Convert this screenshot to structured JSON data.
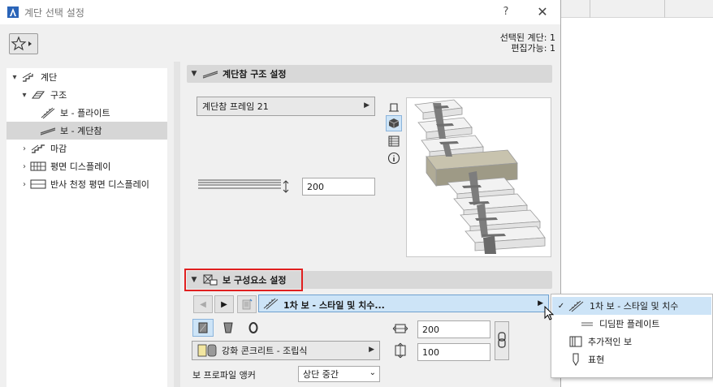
{
  "window": {
    "title": "계단 선택 설정",
    "help": "?",
    "close": "✕"
  },
  "selection_info": {
    "selected": "선택된 계단: 1",
    "editable": "편집가능: 1"
  },
  "tree": [
    {
      "label": "계단",
      "icon": "stair-icon",
      "expanded": true
    },
    {
      "label": "구조",
      "icon": "structure-icon",
      "expanded": true
    },
    {
      "label": "보 - 플라이트",
      "icon": "flight-beam-icon"
    },
    {
      "label": "보 - 계단참",
      "icon": "landing-beam-icon",
      "selected": true
    },
    {
      "label": "마감",
      "icon": "finish-icon"
    },
    {
      "label": "평면 디스플레이",
      "icon": "floorplan-icon"
    },
    {
      "label": "반사 천정 평면 디스플레이",
      "icon": "ceiling-plan-icon"
    }
  ],
  "landing_section": {
    "title": "계단참 구조 설정",
    "frame_dropdown": "계단참 프레임 21",
    "thickness": "200"
  },
  "components_section": {
    "title": "보 구성요소 설정",
    "style_dropdown": "1차 보 - 스타일 및 치수...",
    "width": "200",
    "height": "100",
    "material": "강화 콘크리트 - 조립식",
    "profile_anchor_label": "보 프로파일 앵커",
    "profile_anchor_value": "상단 중간"
  },
  "popup_menu": [
    {
      "label": "1차 보 - 스타일 및 치수",
      "checked": true
    },
    {
      "label": "디딤판 플레이트"
    },
    {
      "label": "추가적인 보"
    },
    {
      "label": "표현"
    }
  ],
  "colors": {
    "highlight": "#e02020",
    "selection": "#cde4f7"
  }
}
